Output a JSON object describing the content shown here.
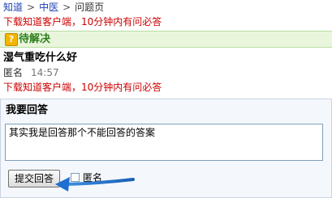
{
  "breadcrumb": {
    "items": [
      "知道",
      "中医"
    ],
    "current": "问题页",
    "separator": ">"
  },
  "promo": {
    "text": "下载知道客户端，10分钟内有问必答"
  },
  "status": {
    "icon": "question-mark-icon",
    "label": "待解决"
  },
  "question": {
    "title": "湿气重吃什么好",
    "author": "匿名",
    "time": "14:57"
  },
  "answer": {
    "header": "我要回答",
    "input_value": "其实我是回答那个不能回答的答案",
    "submit_label": "提交回答",
    "anonymous_label": "匿名",
    "anonymous_checked": false
  },
  "colors": {
    "link": "#1a3fb3",
    "promo": "#cc0000",
    "status_bg": "#e9f6dc",
    "status_text": "#2e7d1b",
    "annotation_arrow": "#1f6fd0"
  }
}
